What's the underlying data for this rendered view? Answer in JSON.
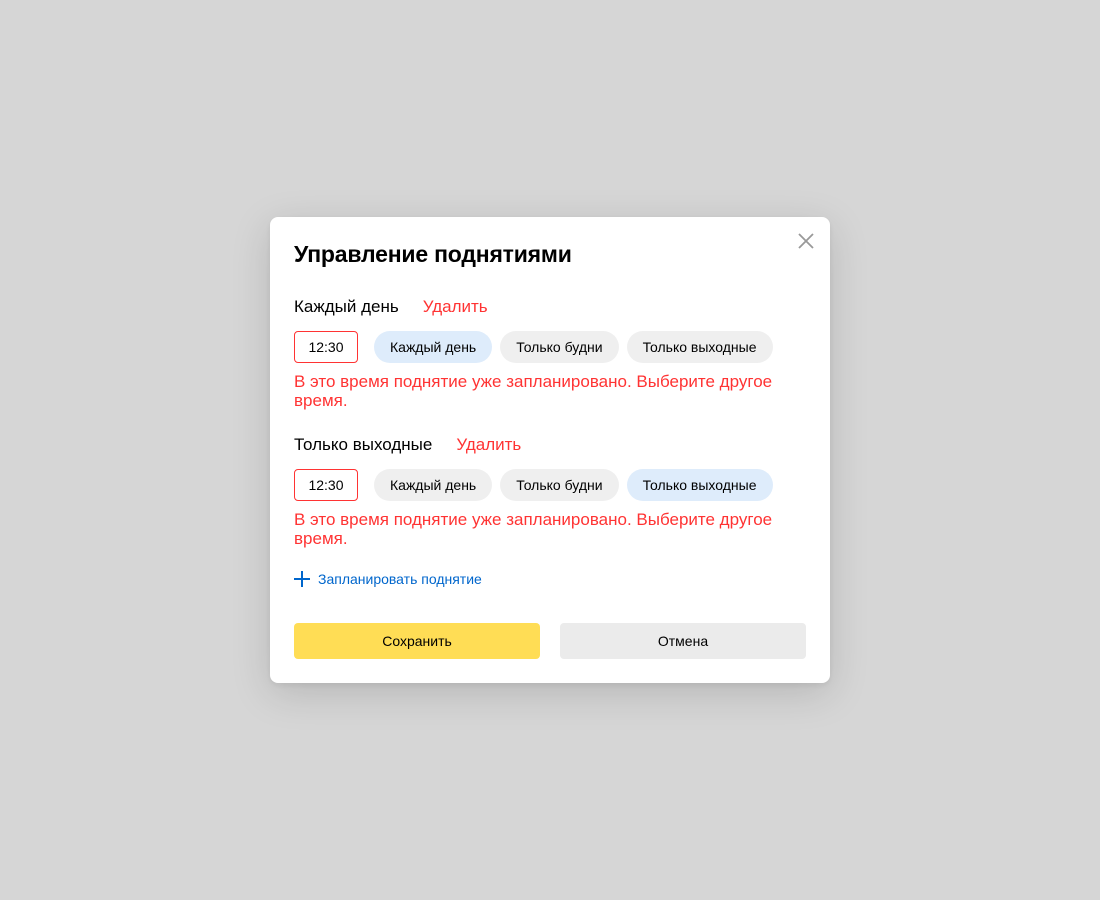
{
  "dialog": {
    "title": "Управление поднятиями",
    "close_icon": "close-icon"
  },
  "schedules": [
    {
      "name": "Каждый день",
      "delete_label": "Удалить",
      "time": "12:30",
      "options": [
        {
          "label": "Каждый день",
          "selected": true
        },
        {
          "label": "Только будни",
          "selected": false
        },
        {
          "label": "Только выходные",
          "selected": false
        }
      ],
      "error": "В это время поднятие уже запланировано. Выберите другое время."
    },
    {
      "name": "Только выходные",
      "delete_label": "Удалить",
      "time": "12:30",
      "options": [
        {
          "label": "Каждый день",
          "selected": false
        },
        {
          "label": "Только будни",
          "selected": false
        },
        {
          "label": "Только выходные",
          "selected": true
        }
      ],
      "error": "В это время поднятие уже запланировано. Выберите другое время."
    }
  ],
  "add_schedule": {
    "label": "Запланировать поднятие",
    "icon": "plus-icon"
  },
  "footer": {
    "save_label": "Сохранить",
    "cancel_label": "Отмена"
  },
  "colors": {
    "error": "#ff3333",
    "link": "#0066cc",
    "primary_button": "#ffdd55",
    "chip_selected": "#deecfb",
    "chip_default": "#efefef"
  }
}
